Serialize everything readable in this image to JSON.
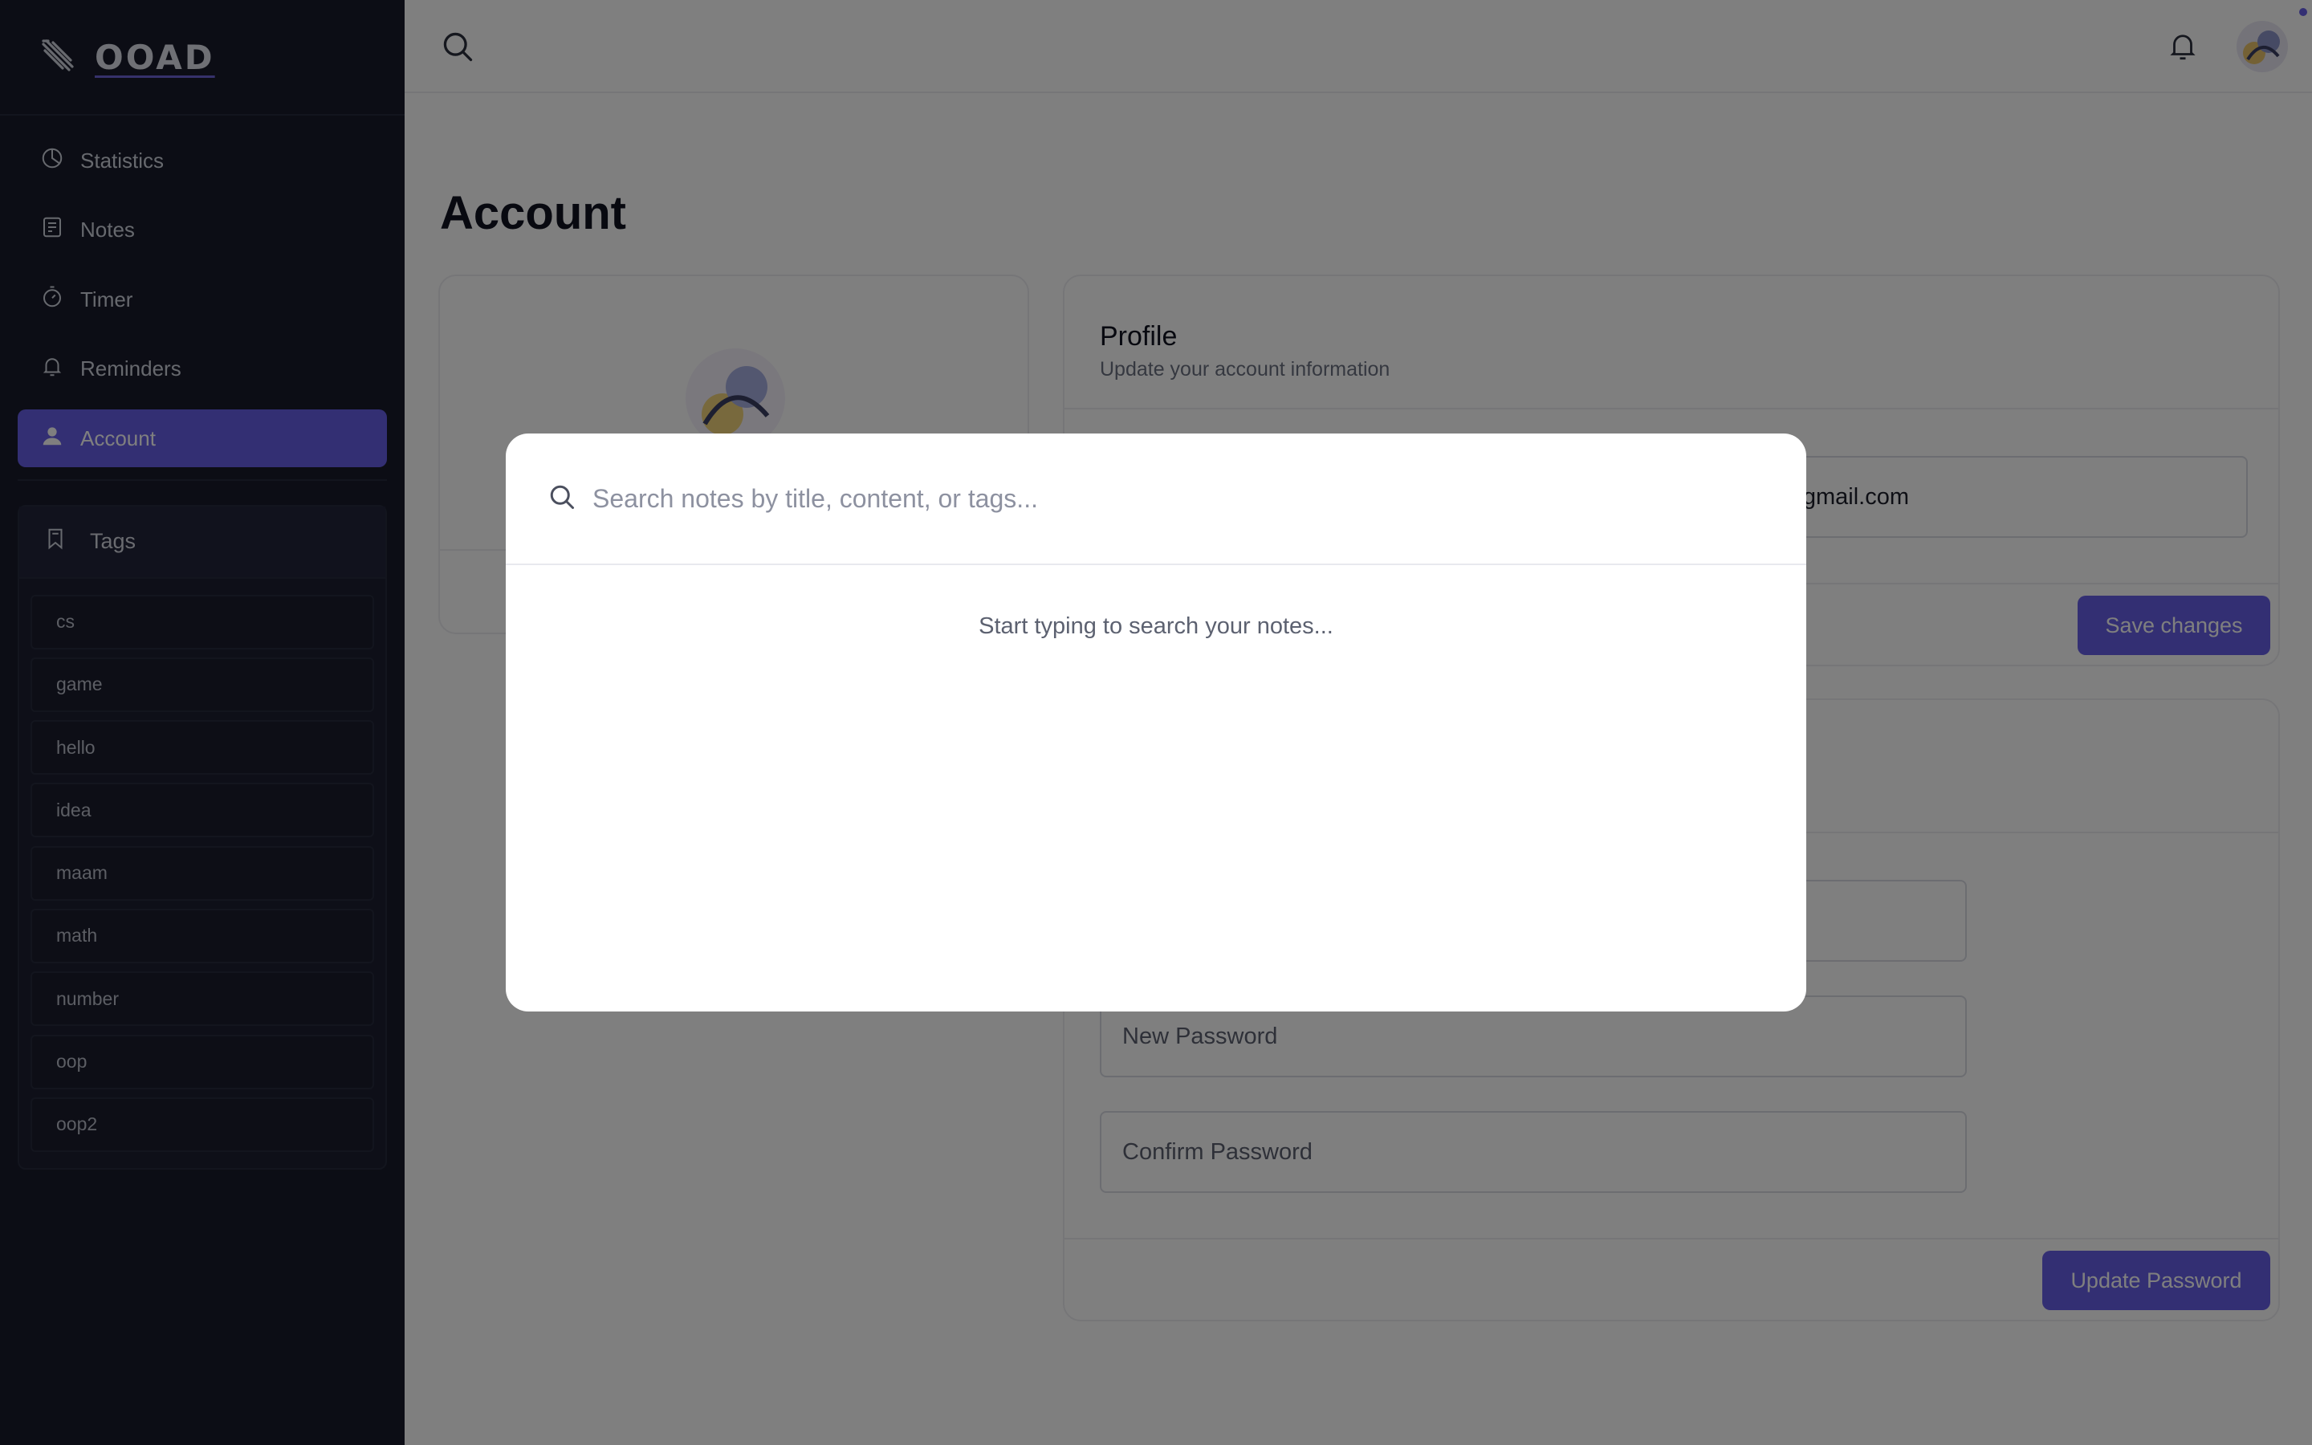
{
  "brand": {
    "name": "OOAD",
    "icon": "pencil-logo-icon"
  },
  "sidebar": {
    "nav": [
      {
        "label": "Statistics",
        "icon": "pie-chart-icon"
      },
      {
        "label": "Notes",
        "icon": "note-icon"
      },
      {
        "label": "Timer",
        "icon": "timer-icon"
      },
      {
        "label": "Reminders",
        "icon": "bell-icon"
      },
      {
        "label": "Account",
        "icon": "user-icon",
        "active": true
      }
    ],
    "tags": {
      "header": "Tags",
      "items": [
        "cs",
        "game",
        "hello",
        "idea",
        "maam",
        "math",
        "number",
        "oop",
        "oop2"
      ]
    }
  },
  "header": {
    "search_icon": "search-icon",
    "notification_icon": "bell-icon"
  },
  "page": {
    "title": "Account"
  },
  "profile": {
    "title": "Profile",
    "subtitle": "Update your account information",
    "email_value": "@gmail.com",
    "save_label": "Save changes"
  },
  "password": {
    "new_placeholder": "New Password",
    "confirm_placeholder": "Confirm Password",
    "update_label": "Update Password"
  },
  "search_modal": {
    "placeholder": "Search notes by title, content, or tags...",
    "empty_text": "Start typing to search your notes..."
  },
  "colors": {
    "accent": "#675fe6",
    "sidebar_bg": "#181b2b"
  }
}
